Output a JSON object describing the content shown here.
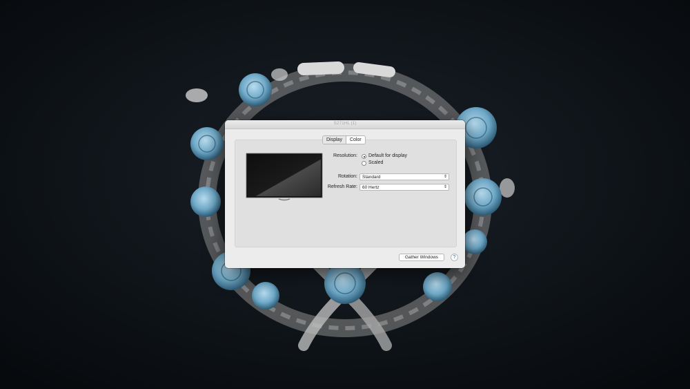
{
  "window": {
    "title": "S271HL (1)"
  },
  "tabs": [
    {
      "label": "Display",
      "active": true
    },
    {
      "label": "Color",
      "active": false
    }
  ],
  "display": {
    "resolution_label": "Resolution:",
    "resolution_options": [
      {
        "label": "Default for display",
        "selected": true
      },
      {
        "label": "Scaled",
        "selected": false
      }
    ],
    "rotation_label": "Rotation:",
    "rotation_value": "Standard",
    "refresh_label": "Refresh Rate:",
    "refresh_value": "60 Hertz"
  },
  "footer": {
    "gather_label": "Gather Windows",
    "help_label": "?"
  },
  "icons": {
    "chevron": "updown-chevron-icon",
    "help": "question-icon"
  },
  "colors": {
    "accent": "#2f6fd6",
    "wallpaper_rose": "#6fa9c8"
  }
}
